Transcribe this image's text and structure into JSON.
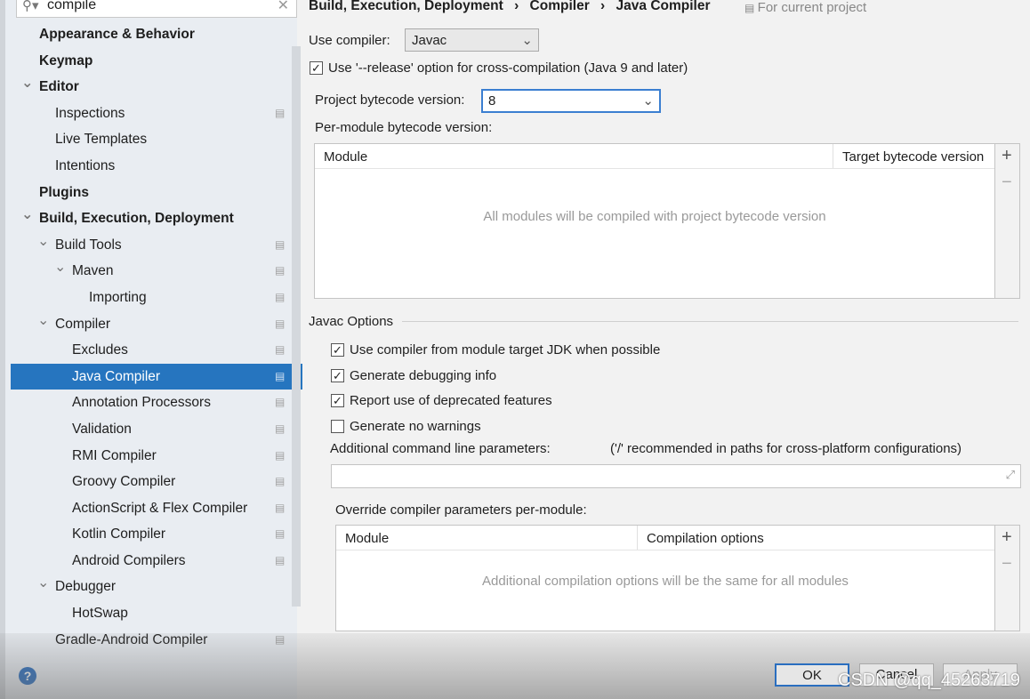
{
  "search": {
    "value": "compile",
    "icon": "search-icon",
    "clear_icon": "close-icon"
  },
  "tree": [
    {
      "label": "Appearance & Behavior",
      "level": 0,
      "bold": true
    },
    {
      "label": "Keymap",
      "level": 0,
      "bold": true
    },
    {
      "label": "Editor",
      "level": 0,
      "bold": true,
      "expanded": true
    },
    {
      "label": "Inspections",
      "level": 1,
      "project": true
    },
    {
      "label": "Live Templates",
      "level": 1
    },
    {
      "label": "Intentions",
      "level": 1
    },
    {
      "label": "Plugins",
      "level": 0,
      "bold": true
    },
    {
      "label": "Build, Execution, Deployment",
      "level": 0,
      "bold": true,
      "expanded": true
    },
    {
      "label": "Build Tools",
      "level": 1,
      "expanded": true,
      "project": true
    },
    {
      "label": "Maven",
      "level": 2,
      "expanded": true,
      "project": true
    },
    {
      "label": "Importing",
      "level": 3,
      "project": true
    },
    {
      "label": "Compiler",
      "level": 1,
      "expanded": true,
      "project": true
    },
    {
      "label": "Excludes",
      "level": 2,
      "project": true
    },
    {
      "label": "Java Compiler",
      "level": 2,
      "project": true,
      "selected": true
    },
    {
      "label": "Annotation Processors",
      "level": 2,
      "project": true
    },
    {
      "label": "Validation",
      "level": 2,
      "project": true
    },
    {
      "label": "RMI Compiler",
      "level": 2,
      "project": true
    },
    {
      "label": "Groovy Compiler",
      "level": 2,
      "project": true
    },
    {
      "label": "ActionScript & Flex Compiler",
      "level": 2,
      "project": true
    },
    {
      "label": "Kotlin Compiler",
      "level": 2,
      "project": true
    },
    {
      "label": "Android Compilers",
      "level": 2,
      "project": true
    },
    {
      "label": "Debugger",
      "level": 1,
      "expanded": true
    },
    {
      "label": "HotSwap",
      "level": 2
    },
    {
      "label": "Gradle-Android Compiler",
      "level": 1,
      "project": true
    }
  ],
  "breadcrumb": [
    "Build, Execution, Deployment",
    "Compiler",
    "Java Compiler"
  ],
  "breadcrumb_sep": "›",
  "for_current_project": "For current project",
  "use_compiler_label": "Use compiler:",
  "use_compiler_value": "Javac",
  "release_option": {
    "label": "Use '--release' option for cross-compilation (Java 9 and later)",
    "checked": true
  },
  "project_bytecode_label": "Project bytecode version:",
  "project_bytecode_value": "8",
  "per_module_label": "Per-module bytecode version:",
  "module_table": {
    "columns": [
      "Module",
      "Target bytecode version"
    ],
    "empty": "All modules will be compiled with project bytecode version"
  },
  "javac_options": "Javac Options",
  "javac_checks": [
    {
      "label": "Use compiler from module target JDK when possible",
      "checked": true
    },
    {
      "label": "Generate debugging info",
      "checked": true
    },
    {
      "label": "Report use of deprecated features",
      "checked": true
    },
    {
      "label": "Generate no warnings",
      "checked": false
    }
  ],
  "additional_label": "Additional command line parameters:",
  "additional_hint": "('/' recommended in paths for cross-platform configurations)",
  "additional_value": "",
  "override_label": "Override compiler parameters per-module:",
  "override_table": {
    "columns": [
      "Module",
      "Compilation options"
    ],
    "empty": "Additional compilation options will be the same for all modules"
  },
  "add": "+",
  "remove": "−",
  "buttons": {
    "ok": "OK",
    "cancel": "Cancel",
    "apply": "Apply"
  },
  "help": "?",
  "watermark": "CSDN @qq_45263719"
}
